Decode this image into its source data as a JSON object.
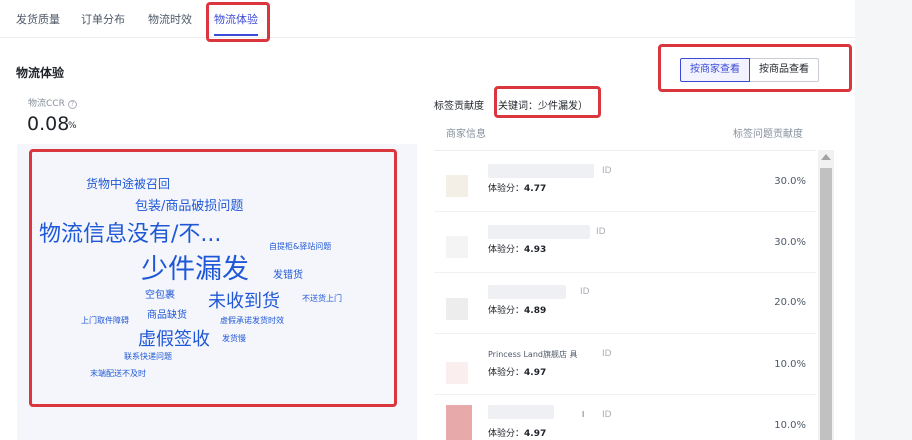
{
  "tabs": [
    {
      "label": "发货质量",
      "active": false
    },
    {
      "label": "订单分布",
      "active": false
    },
    {
      "label": "物流时效",
      "active": false
    },
    {
      "label": "物流体验",
      "active": true
    }
  ],
  "section_title": "物流体验",
  "view_buttons": {
    "by_merchant": "按商家查看",
    "by_product": "按商品查看"
  },
  "ccr": {
    "label": "物流CCR",
    "help": "?",
    "value": "0.08",
    "unit": "%"
  },
  "word_cloud": [
    "货物中途被召回",
    "包装/商品破损问题",
    "物流信息没有/不...",
    "自提柜&驿站问题",
    "少件漏发",
    "发错货",
    "空包裹",
    "未收到货",
    "不送货上门",
    "上门取件障碍",
    "商品缺货",
    "虚假承诺发货时效",
    "虚假签收",
    "发货慢",
    "联系快递问题",
    "末端配送不及时"
  ],
  "tag_panel": {
    "title": "标签贡献度",
    "keyword": "关键词：少件漏发）"
  },
  "table": {
    "headers": {
      "merchant": "商家信息",
      "contribution": "标签问题贡献度"
    },
    "score_label": "体验分：",
    "rows": [
      {
        "name": "",
        "id": "ID",
        "score": "4.77",
        "pct": "30.0%"
      },
      {
        "name": "",
        "id": "ID",
        "score": "4.93",
        "pct": "30.0%"
      },
      {
        "name": "",
        "id": "ID",
        "score": "4.89",
        "pct": "20.0%"
      },
      {
        "name": "Princess Land旗舰店 具",
        "id": "ID",
        "score": "4.97",
        "pct": "10.0%"
      },
      {
        "name": "l",
        "id": "ID",
        "score": "4.97",
        "pct": "10.0%"
      }
    ]
  },
  "colors": {
    "accent": "#3c4bd6",
    "annotation": "#d9363e",
    "cloud_text": "#1f58d6"
  }
}
